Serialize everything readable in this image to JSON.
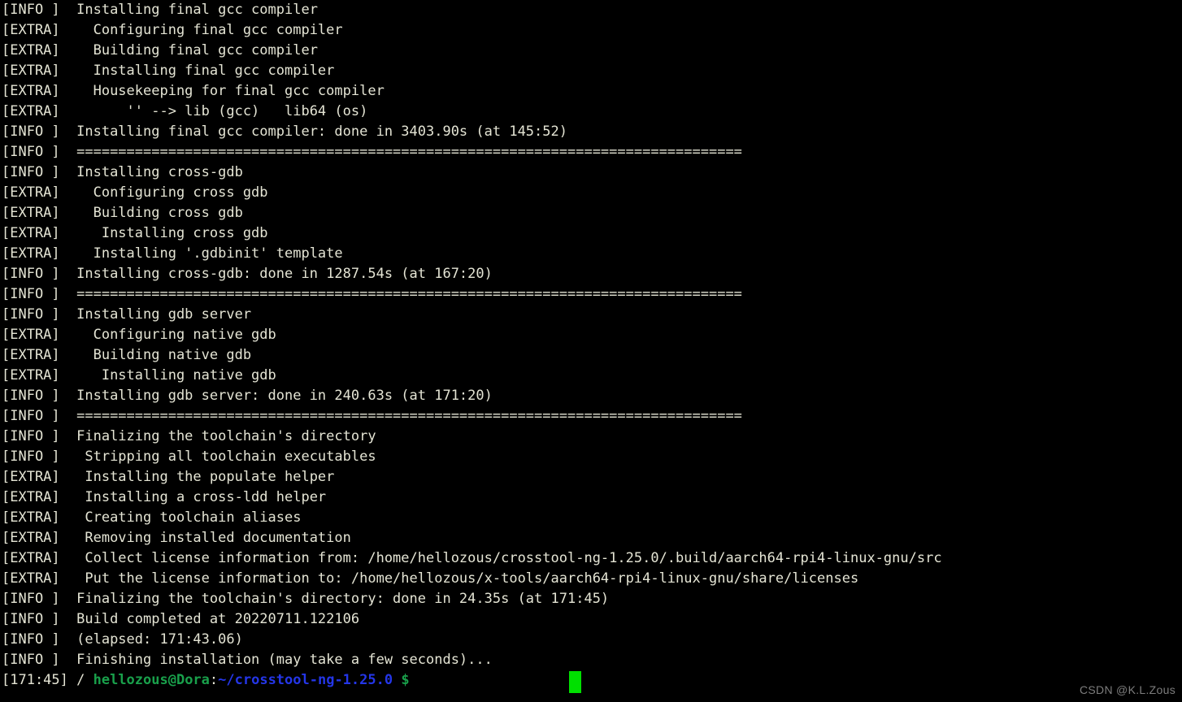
{
  "terminal": {
    "background_color": "#000000",
    "text_color": "#e4e4d4",
    "prompt_user_color": "#19a04b",
    "prompt_path_color": "#2436e8",
    "cursor_color": "#00e000",
    "separator": "================================================================================",
    "lines": [
      {
        "tag": "[INFO ]",
        "msg": "  Installing final gcc compiler"
      },
      {
        "tag": "[EXTRA]",
        "msg": "    Configuring final gcc compiler"
      },
      {
        "tag": "[EXTRA]",
        "msg": "    Building final gcc compiler"
      },
      {
        "tag": "[EXTRA]",
        "msg": "    Installing final gcc compiler"
      },
      {
        "tag": "[EXTRA]",
        "msg": "    Housekeeping for final gcc compiler"
      },
      {
        "tag": "[EXTRA]",
        "msg": "        '' --> lib (gcc)   lib64 (os)"
      },
      {
        "tag": "[INFO ]",
        "msg": "  Installing final gcc compiler: done in 3403.90s (at 145:52)"
      },
      {
        "tag": "[INFO ]",
        "msg": "  ================================================================================"
      },
      {
        "tag": "[INFO ]",
        "msg": "  Installing cross-gdb"
      },
      {
        "tag": "[EXTRA]",
        "msg": "    Configuring cross gdb"
      },
      {
        "tag": "[EXTRA]",
        "msg": "    Building cross gdb"
      },
      {
        "tag": "[EXTRA]",
        "msg": "     Installing cross gdb"
      },
      {
        "tag": "[EXTRA]",
        "msg": "    Installing '.gdbinit' template"
      },
      {
        "tag": "[INFO ]",
        "msg": "  Installing cross-gdb: done in 1287.54s (at 167:20)"
      },
      {
        "tag": "[INFO ]",
        "msg": "  ================================================================================"
      },
      {
        "tag": "[INFO ]",
        "msg": "  Installing gdb server"
      },
      {
        "tag": "[EXTRA]",
        "msg": "    Configuring native gdb"
      },
      {
        "tag": "[EXTRA]",
        "msg": "    Building native gdb"
      },
      {
        "tag": "[EXTRA]",
        "msg": "     Installing native gdb"
      },
      {
        "tag": "[INFO ]",
        "msg": "  Installing gdb server: done in 240.63s (at 171:20)"
      },
      {
        "tag": "[INFO ]",
        "msg": "  ================================================================================"
      },
      {
        "tag": "[INFO ]",
        "msg": "  Finalizing the toolchain's directory"
      },
      {
        "tag": "[INFO ]",
        "msg": "   Stripping all toolchain executables"
      },
      {
        "tag": "[EXTRA]",
        "msg": "   Installing the populate helper"
      },
      {
        "tag": "[EXTRA]",
        "msg": "   Installing a cross-ldd helper"
      },
      {
        "tag": "[EXTRA]",
        "msg": "   Creating toolchain aliases"
      },
      {
        "tag": "[EXTRA]",
        "msg": "   Removing installed documentation"
      },
      {
        "tag": "[EXTRA]",
        "msg": "   Collect license information from: /home/hellozous/crosstool-ng-1.25.0/.build/aarch64-rpi4-linux-gnu/src"
      },
      {
        "tag": "[EXTRA]",
        "msg": "   Put the license information to: /home/hellozous/x-tools/aarch64-rpi4-linux-gnu/share/licenses"
      },
      {
        "tag": "[INFO ]",
        "msg": "  Finalizing the toolchain's directory: done in 24.35s (at 171:45)"
      },
      {
        "tag": "[INFO ]",
        "msg": "  Build completed at 20220711.122106"
      },
      {
        "tag": "[INFO ]",
        "msg": "  (elapsed: 171:43.06)"
      },
      {
        "tag": "[INFO ]",
        "msg": "  Finishing installation (may take a few seconds)..."
      }
    ]
  },
  "prompt": {
    "time": "[171:45]",
    "slash": " / ",
    "user_host": "hellozous@Dora",
    "colon": ":",
    "path": "~/crosstool-ng-1.25.0",
    "dollar": " $"
  },
  "watermark": {
    "text": "CSDN @K.L.Zous"
  }
}
